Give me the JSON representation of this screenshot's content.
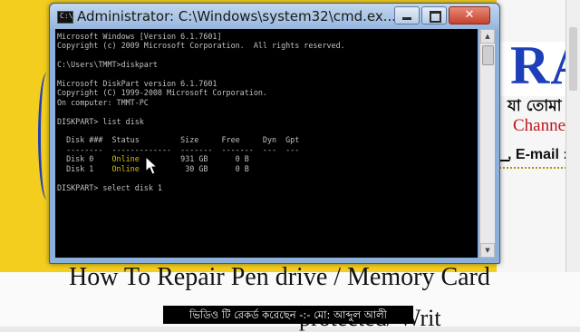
{
  "window": {
    "title": "Administrator: C:\\Windows\\system32\\cmd.ex...",
    "icon_text": "C:\\",
    "buttons": {
      "minimize": "minimize-icon",
      "maximize": "maximize-icon",
      "close_label": "✕"
    }
  },
  "console": {
    "lines": [
      "Microsoft Windows [Version 6.1.7601]",
      "Copyright (c) 2009 Microsoft Corporation.  All rights reserved.",
      "",
      "C:\\Users\\TMMT>diskpart",
      "",
      "Microsoft DiskPart version 6.1.7601",
      "Copyright (C) 1999-2008 Microsoft Corporation.",
      "On computer: TMMT-PC",
      "",
      "DISKPART> list disk",
      "",
      "  Disk ###  Status         Size     Free     Dyn  Gpt",
      "  --------  -------------  -------  -------  ---  ---"
    ],
    "disk_rows": [
      {
        "prefix": "  Disk 0    ",
        "status": "Online",
        "rest": "         931 GB      0 B"
      },
      {
        "prefix": "  Disk 1    ",
        "status": "Online",
        "rest": "          30 GB      0 B"
      }
    ],
    "after_lines": [
      "",
      "DISKPART> select disk 1"
    ]
  },
  "background": {
    "ra_text": "RA",
    "bangla_text": "যা তোমা",
    "channel_text": "Channel",
    "email_text": ", E-mail :",
    "heading": "How To Repair Pen drive / Memory Card",
    "heading2": "protected/ Writ"
  },
  "caption": "ভিডিও টি রেকর্ড করেছেন  -:-   মো: আব্দুল আলী",
  "colors": {
    "console_bg": "#000000",
    "console_text": "#c0c0c0",
    "online_status": "#d7c000",
    "title_bar": "#96b6de",
    "doc_bg": "#f4ce1f"
  }
}
